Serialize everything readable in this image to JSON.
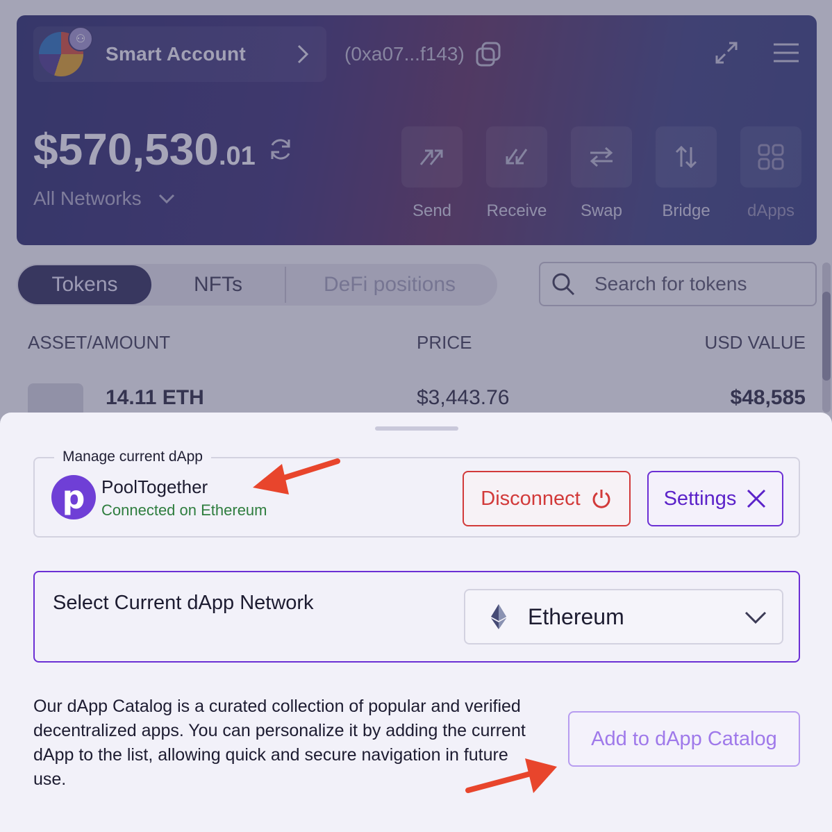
{
  "dashboard": {
    "account_name": "Smart Account",
    "address": "(0xa07...f143)",
    "balance_whole": "$570,530",
    "balance_cents": ".01",
    "network_filter": "All Networks",
    "actions": [
      {
        "label": "Send",
        "icon": "send-arrow-icon"
      },
      {
        "label": "Receive",
        "icon": "receive-arrow-icon"
      },
      {
        "label": "Swap",
        "icon": "swap-icon"
      },
      {
        "label": "Bridge",
        "icon": "bridge-icon"
      },
      {
        "label": "dApps",
        "icon": "grid-icon"
      }
    ],
    "tabs": [
      "Tokens",
      "NFTs",
      "DeFi positions"
    ],
    "search_placeholder": "Search for tokens",
    "table_headers": [
      "ASSET/AMOUNT",
      "PRICE",
      "USD VALUE"
    ],
    "rows": [
      {
        "amount": "14.11 ETH",
        "price": "$3,443.76",
        "usd_value": "$48,585"
      }
    ]
  },
  "sheet": {
    "manage_legend": "Manage current dApp",
    "dapp_logo_letter": "p",
    "dapp_name": "PoolTogether",
    "dapp_status": "Connected on Ethereum",
    "disconnect_label": "Disconnect",
    "settings_label": "Settings",
    "network_title": "Select Current dApp Network",
    "network_selected": "Ethereum",
    "description": "Our dApp Catalog is a curated collection of popular and verified decentralized apps. You can personalize it by adding the current dApp to the list, allowing quick and secure navigation in future use.",
    "add_catalog_label": "Add to dApp Catalog"
  },
  "colors": {
    "accent_purple": "#6b2fd4",
    "danger_red": "#d23a3a",
    "success_green": "#2e7d3e",
    "annotation_arrow": "#e8452c"
  }
}
